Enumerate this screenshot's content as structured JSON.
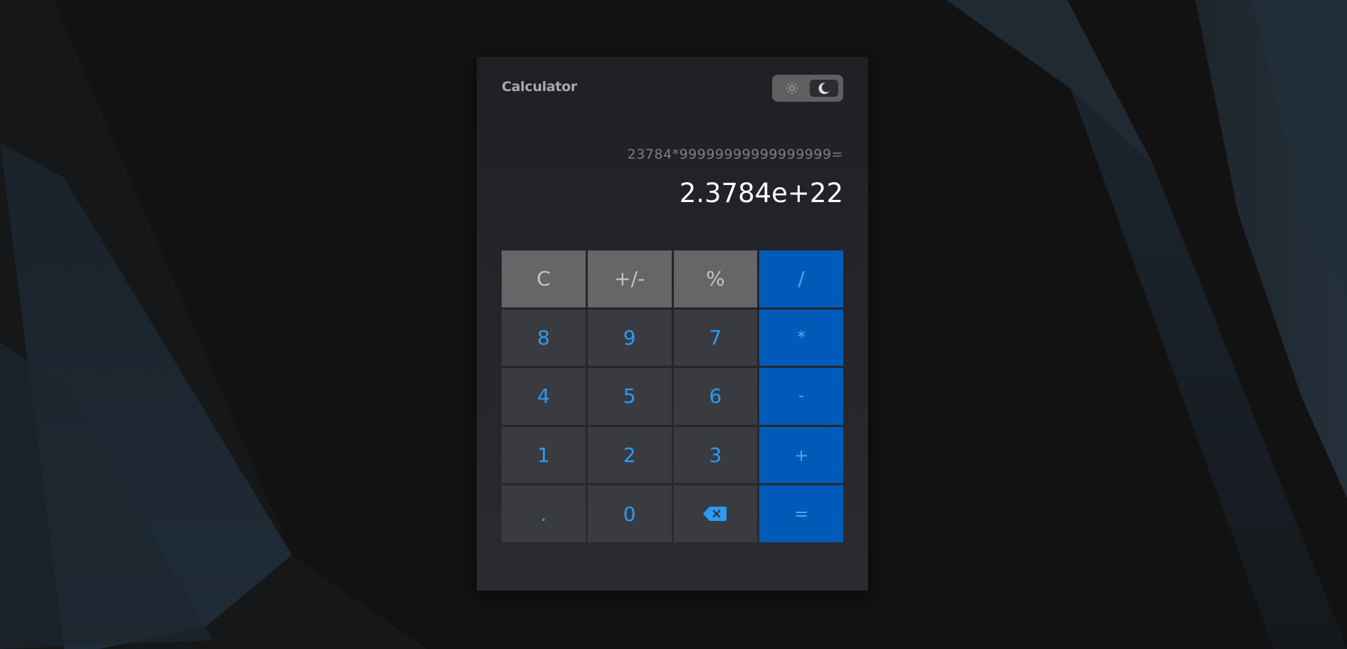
{
  "app": {
    "title": "Calculator"
  },
  "theme_toggle": {
    "light_icon": "sun-icon",
    "dark_icon": "moon-icon",
    "selected": "dark"
  },
  "display": {
    "expression": "23784*99999999999999999=",
    "result": "2.3784e+22"
  },
  "keys": {
    "clear": "C",
    "negate": "+/-",
    "percent": "%",
    "divide": "/",
    "eight": "8",
    "nine": "9",
    "seven": "7",
    "multiply": "*",
    "four": "4",
    "five": "5",
    "six": "6",
    "subtract": "-",
    "one": "1",
    "two": "2",
    "three": "3",
    "add": "+",
    "decimal": ".",
    "zero": "0",
    "backspace_icon": "backspace-icon",
    "equals": "="
  },
  "colors": {
    "page_background": "#121212",
    "panel_background": "#232428",
    "function_key": "#666668",
    "digit_key": "#3a3b40",
    "operator_key": "#005bb8",
    "accent_text": "#2b9bf4"
  }
}
